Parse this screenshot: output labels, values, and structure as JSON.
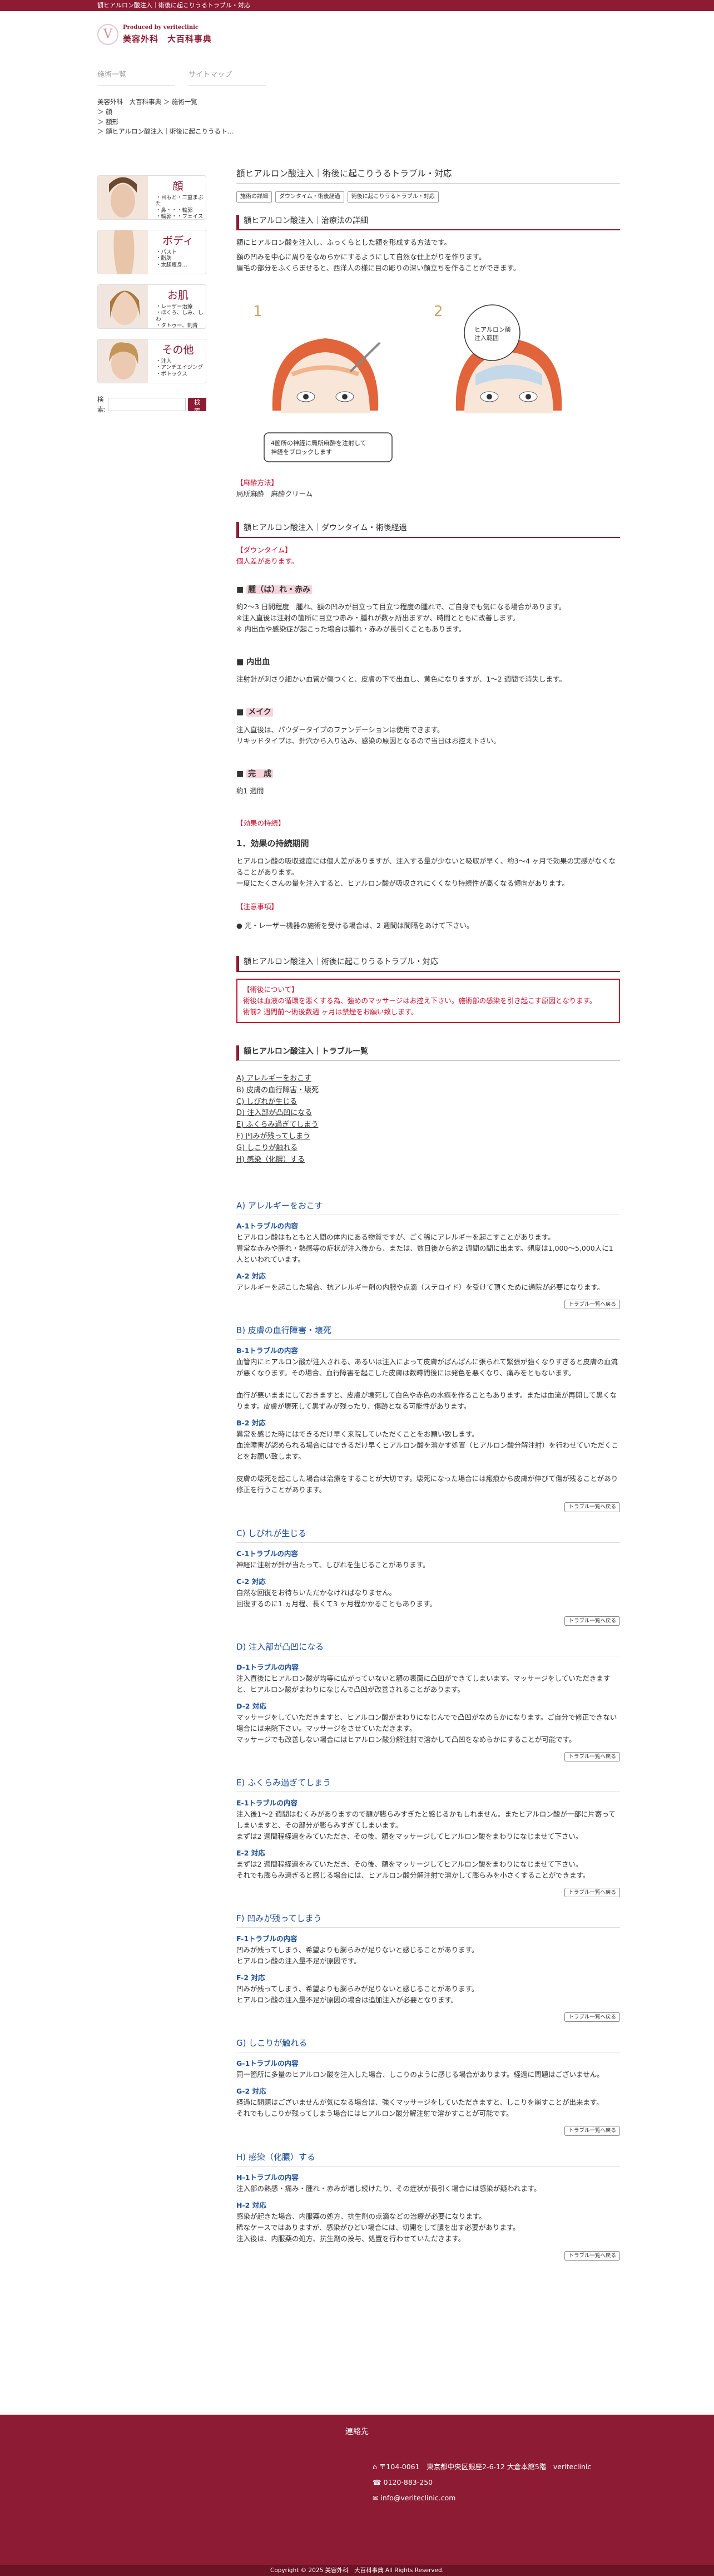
{
  "topbar": "額ヒアルロン酸注入｜術後に起こりうるトラブル・対応",
  "logo": {
    "sub": "Produced by veriteclinic",
    "main": "美容外科　大百科事典"
  },
  "nav": [
    "施術一覧",
    "サイトマップ"
  ],
  "breadcrumb": [
    "美容外科　大百科事典 ＞ 施術一覧",
    "＞ 顔",
    "＞ 額形",
    "＞ 額ヒアルロン酸注入｜術後に起こりうるト..."
  ],
  "sidebar": [
    {
      "title": "顔",
      "items": [
        "目もと・二重まぶた",
        "鼻・・・輪郭",
        "輪郭・・フェイスリフト"
      ]
    },
    {
      "title": "ボディ",
      "items": [
        "バスト",
        "脂肪",
        "太腿痩身..."
      ]
    },
    {
      "title": "お肌",
      "items": [
        "レーザー治療",
        "ほくろ、しみ、しわ",
        "タトゥー、刺青"
      ]
    },
    {
      "title": "その他",
      "items": [
        "注入",
        "アンチエイジング",
        "ボトックス"
      ]
    }
  ],
  "search": {
    "label": "検索:",
    "button": "検索"
  },
  "page_title": "額ヒアルロン酸注入｜術後に起こりうるトラブル・対応",
  "tags": [
    "施術の詳細",
    "ダウンタイム・術後経過",
    "術後に起こりうるトラブル・対応"
  ],
  "sections": {
    "detail": {
      "heading": "額ヒアルロン酸注入｜治療法の詳細",
      "paras": [
        "額にヒアルロン酸を注入し、ふっくらとした額を形成する方法です。",
        "額の凹みを中心に周りをなめらかにするようにして自然な仕上がりを作ります。",
        "眉毛の部分をふくらませると、西洋人の様に目の彫りの深い顔立ちを作ることができます。"
      ],
      "fig1": "1",
      "fig2": "2",
      "bubble": "ヒアルロン酸\n注入範囲",
      "note": "4箇所の神経に局所麻酔を注射して\n神経をブロックします"
    },
    "anesthesia": {
      "label": "【麻酔方法】",
      "text": "局所麻酔　麻酔クリーム"
    },
    "downtime": {
      "heading": "額ヒアルロン酸注入｜ダウンタイム・術後経過",
      "label": "【ダウンタイム】",
      "value": "個人差があります。",
      "items": [
        {
          "title": "腫（は）れ・赤み",
          "text": "約2〜3 日間程度　腫れ、額の凹みが目立って目立つ程度の腫れで、ご自身でも気になる場合があります。\n※注入直後は注射の箇所に目立つ赤み・腫れが数ヶ所出ますが、時間とともに改善します。\n※ 内出血や感染症が起こった場合は腫れ・赤みが長引くこともあります。"
        },
        {
          "title": "内出血",
          "text": "注射針が刺さり細かい血管が傷つくと、皮膚の下で出血し、黄色になりますが、1〜2 週間で消失します。"
        },
        {
          "title": "メイク",
          "text": "注入直後は、パウダータイプのファンデーションは使用できます。\nリキッドタイプは、針穴から入り込み、感染の原因となるので当日はお控え下さい。"
        },
        {
          "title": "完　成",
          "text": "約1 週間"
        }
      ],
      "effect_label": "【効果の持続】",
      "effect_title": "1．効果の持続期間",
      "effect_text": "ヒアルロン酸の吸収速度には個人差がありますが、注入する量が少ないと吸収が早く、約3〜4 ヶ月で効果の実感がなくなることがあります。\n一度にたくさんの量を注入すると、ヒアルロン酸が吸収されにくくなり持続性が高くなる傾向があります。",
      "notes_label": "【注意事項】",
      "notes_text": "● 光・レーザー機器の施術を受ける場合は、2 週間は間隔をあけて下さい。"
    },
    "trouble": {
      "heading": "額ヒアルロン酸注入｜術後に起こりうるトラブル・対応",
      "box_label": "【術後について】",
      "box_text": "術後は血液の循環を悪くする為、強めのマッサージはお控え下さい。施術部の感染を引き起こす原因となります。\n術前2 週間前〜術後数週 ヶ月は禁煙をお願い致します。"
    },
    "toc_heading": "額ヒアルロン酸注入｜トラブル一覧",
    "toc": [
      "A) アレルギーをおこす",
      "B) 皮膚の血行障害・壊死",
      "C) しびれが生じる",
      "D) 注入部が凸凹になる",
      "E) ふくらみ過ぎてしまう",
      "F) 凹みが残ってしまう",
      "G) しこりが触れる",
      "H) 感染（化膿）する"
    ]
  },
  "troubles": [
    {
      "title": "A) アレルギーをおこす",
      "items": [
        {
          "sub": "A-1トラブルの内容",
          "text": "ヒアルロン酸はもともと人間の体内にある物質ですが、ごく稀にアレルギーを起こすことがあります。\n異常な赤みや腫れ・熱感等の症状が注入後から、または、数日後から約2 週間の間に出ます。頻度は1,000〜5,000人に1人といわれています。"
        },
        {
          "sub": "A-2 対応",
          "text": "アレルギーを起こした場合、抗アレルギー剤の内服や点滴（ステロイド）を受けて頂くために通院が必要になります。"
        }
      ]
    },
    {
      "title": "B) 皮膚の血行障害・壊死",
      "items": [
        {
          "sub": "B-1トラブルの内容",
          "text": "血管内にヒアルロン酸が注入される、あるいは注入によって皮膚がぱんぱんに張られて緊張が強くなりすぎると皮膚の血流が悪くなります。その場合、血行障害を起こした皮膚は数時間後には発色を悪くなり、痛みをともないます。\n\n血行が悪いままにしておきますと、皮膚が壊死して白色や赤色の水疱を作ることもあります。または血流が再開して黒くなります。皮膚が壊死して黒ずみが残ったり、傷跡となる可能性があります。"
        },
        {
          "sub": "B-2 対応",
          "text": "異常を感じた時にはできるだけ早く来院していただくことをお願い致します。\n血流障害が認められる場合にはできるだけ早くヒアルロン酸を溶かす処置（ヒアルロン酸分解注射）を行わせていただくことをお願い致します。\n\n皮膚の壊死を起こした場合は治療をすることが大切です。壊死になった場合には瘢痕から皮膚が伸びて傷が残ることがあり修正を行うことがあります。"
        }
      ]
    },
    {
      "title": "C) しびれが生じる",
      "items": [
        {
          "sub": "C-1トラブルの内容",
          "text": "神経に注射が針が当たって、しびれを生じることがあります。"
        },
        {
          "sub": "C-2 対応",
          "text": "自然な回復をお待ちいただかなければなりません。\n回復するのに1 ヵ月程、長くて3 ヶ月程かかることもあります。"
        }
      ]
    },
    {
      "title": "D) 注入部が凸凹になる",
      "items": [
        {
          "sub": "D-1トラブルの内容",
          "text": "注入直後にヒアルロン酸が均等に広がっていないと額の表面に凸凹ができてしまいます。マッサージをしていただきますと、ヒアルロン酸がまわりになじんで凸凹が改善されることがあります。"
        },
        {
          "sub": "D-2 対応",
          "text": "マッサージをしていただきますと、ヒアルロン酸がまわりになじんでで凸凹がなめらかになります。ご自分で修正できない場合には来院下さい。マッサージをさせていただきます。\nマッサージでも改善しない場合にはヒアルロン酸分解注射で溶かして凸凹をなめらかにすることが可能です。"
        }
      ]
    },
    {
      "title": "E) ふくらみ過ぎてしまう",
      "items": [
        {
          "sub": "E-1トラブルの内容",
          "text": "注入後1〜2 週間はむくみがありますので額が膨らみすぎたと感じるかもしれません。またヒアルロン酸が一部に片寄ってしまいますと、その部分が膨らみすぎてしまいます。\nまずは2 週間程経過をみていただき、その後、額をマッサージしてヒアルロン酸をまわりになじませて下さい。"
        },
        {
          "sub": "E-2 対応",
          "text": "まずは2 週間程経過をみていただき、その後、額をマッサージしてヒアルロン酸をまわりになじませて下さい。\nそれでも膨らみ過ぎると感じる場合には、ヒアルロン酸分解注射で溶かして膨らみを小さくすることができます。"
        }
      ]
    },
    {
      "title": "F) 凹みが残ってしまう",
      "items": [
        {
          "sub": "F-1トラブルの内容",
          "text": "凹みが残ってしまう、希望よりも膨らみが足りないと感じることがあります。\nヒアルロン酸の注入量不足が原因です。"
        },
        {
          "sub": "F-2 対応",
          "text": "凹みが残ってしまう、希望よりも膨らみが足りないと感じることがあります。\nヒアルロン酸の注入量不足が原因の場合は追加注入が必要となります。"
        }
      ]
    },
    {
      "title": "G) しこりが触れる",
      "items": [
        {
          "sub": "G-1トラブルの内容",
          "text": "同一箇所に多量のヒアルロン酸を注入した場合、しこりのように感じる場合があります。経過に問題はございません。"
        },
        {
          "sub": "G-2 対応",
          "text": "経過に問題はございませんが気になる場合は、強くマッサージをしていただきますと、しこりを崩すことが出来ます。\nそれでもしこりが残ってしまう場合にはヒアルロン酸分解注射で溶かすことが可能です。"
        }
      ]
    },
    {
      "title": "H) 感染（化膿）する",
      "items": [
        {
          "sub": "H-1トラブルの内容",
          "text": "注入部の熱感・痛み・腫れ・赤みが増し続けたり、その症状が長引く場合には感染が疑われます。"
        },
        {
          "sub": "H-2 対応",
          "text": "感染が起きた場合、内服薬の処方、抗生剤の点滴などの治療が必要になります。\n稀なケースではありますが、感染がひどい場合には、切開をして膿を出す必要があります。\n注入後は、内服薬の処方、抗生剤の投与、処置を行わせていただきます。"
        }
      ]
    }
  ],
  "more_label": "トラブル一覧へ戻る",
  "footer": {
    "title": "連絡先",
    "address": "〒104-0061　東京都中央区銀座2-6-12 大倉本館5階　veriteclinic",
    "tel": "0120-883-250",
    "mail": "info@veriteclinic.com",
    "copyright": "Copyright © 2025 美容外科　大百科事典 All Rights Reserved."
  },
  "colors": {
    "brand": "#8c1b33",
    "accent_red": "#c8102e",
    "link_blue": "#1d4f9a"
  }
}
